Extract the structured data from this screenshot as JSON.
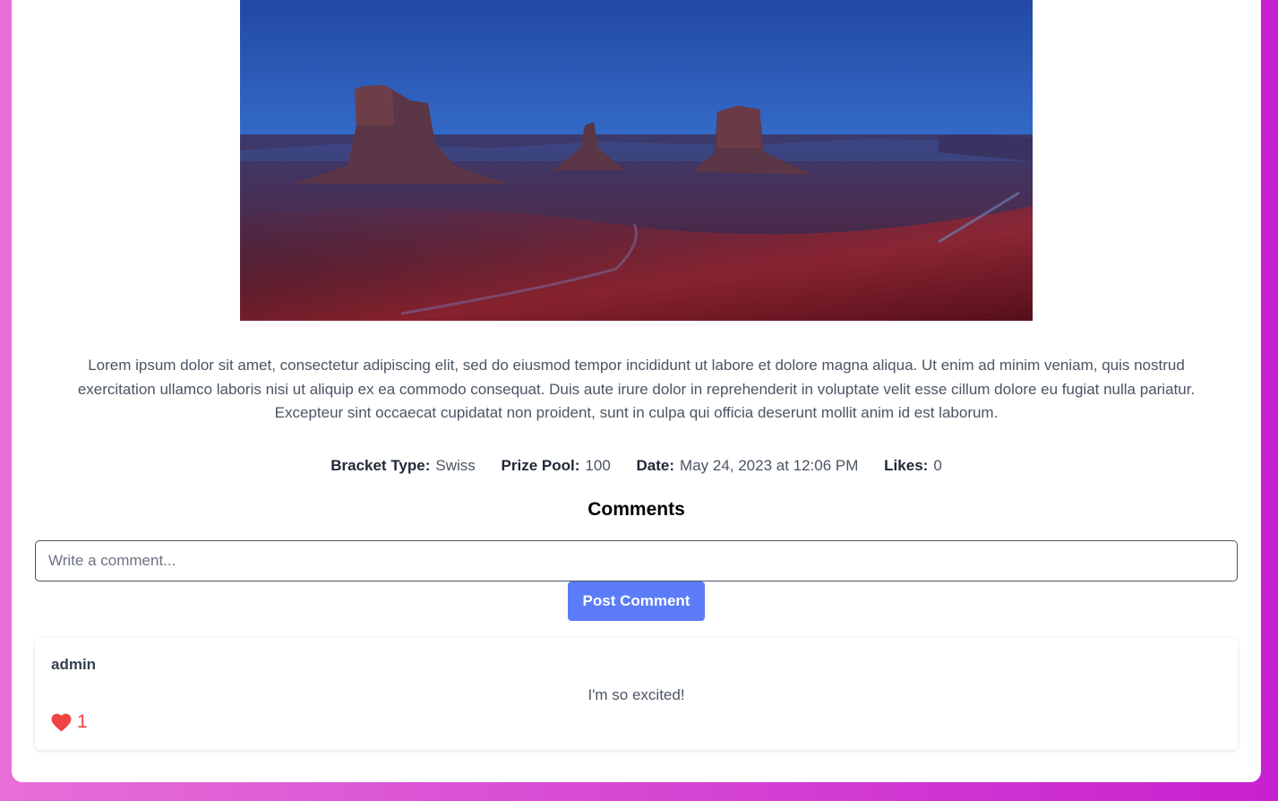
{
  "post": {
    "image_alt": "Desert buttes landscape at twilight",
    "description": "Lorem ipsum dolor sit amet, consectetur adipiscing elit, sed do eiusmod tempor incididunt ut labore et dolore magna aliqua. Ut enim ad minim veniam, quis nostrud exercitation ullamco laboris nisi ut aliquip ex ea commodo consequat. Duis aute irure dolor in reprehenderit in voluptate velit esse cillum dolore eu fugiat nulla pariatur. Excepteur sint occaecat cupidatat non proident, sunt in culpa qui officia deserunt mollit anim id est laborum."
  },
  "meta": {
    "bracket_label": "Bracket Type:",
    "bracket_value": "Swiss",
    "prize_label": "Prize Pool:",
    "prize_value": "100",
    "date_label": "Date:",
    "date_value": "May 24, 2023 at 12:06 PM",
    "likes_label": "Likes:",
    "likes_value": "0"
  },
  "comments": {
    "title": "Comments",
    "input_placeholder": "Write a comment...",
    "post_button_label": "Post Comment",
    "items": [
      {
        "author": "admin",
        "text": "I'm so excited!",
        "likes": "1",
        "like_icon": "heart-icon"
      }
    ]
  },
  "colors": {
    "background_gradient_start": "#e76fd8",
    "background_gradient_end": "#c820cf",
    "button": "#5b7cf6",
    "heart": "#ef4444"
  }
}
